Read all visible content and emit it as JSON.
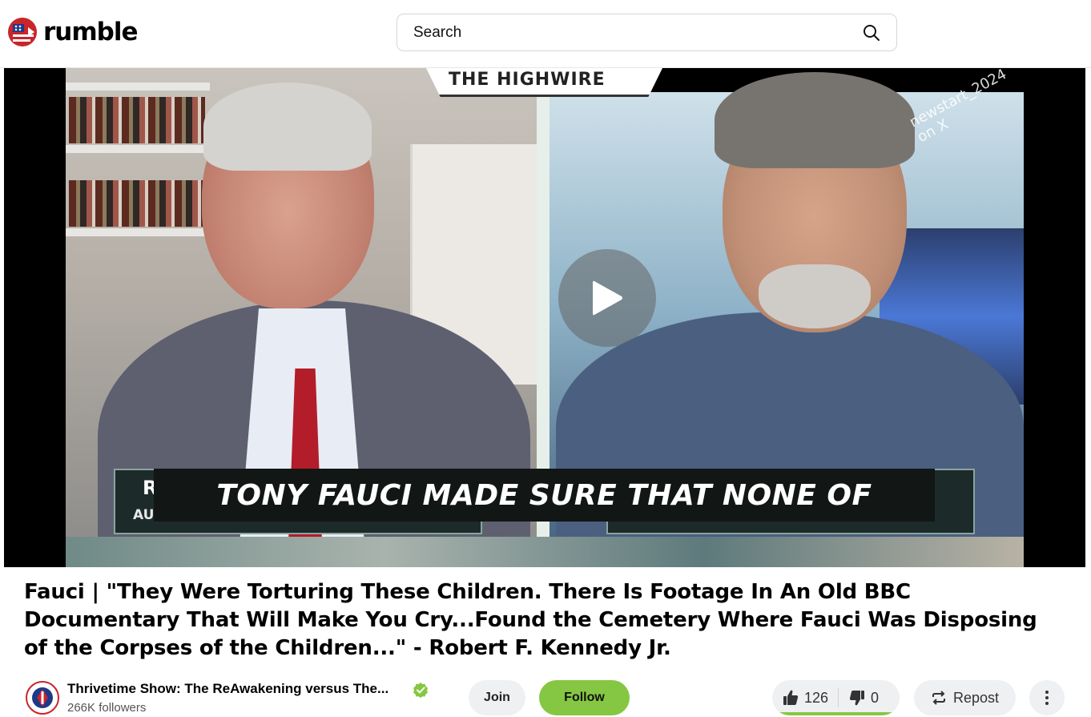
{
  "header": {
    "logo_text": "rumble",
    "search_placeholder": "Search"
  },
  "video": {
    "banner_text": "THE HIGHWIRE",
    "watermark": "newstart_2024 on X",
    "caption": "TONY FAUCI MADE SURE THAT NONE OF",
    "lower_third_letter": "R",
    "lower_third_sub": "AU"
  },
  "title": "Fauci | \"They Were Torturing These Children. There Is Footage In An Old BBC Documentary That Will Make You Cry...Found the Cemetery Where Fauci Was Disposing of the Corpses of the Children...\" - Robert F. Kennedy Jr.",
  "channel": {
    "name": "Thrivetime Show: The ReAwakening versus The...",
    "followers": "266K followers",
    "verified_color": "#85c742"
  },
  "actions": {
    "join_label": "Join",
    "follow_label": "Follow",
    "likes": "126",
    "dislikes": "0",
    "repost_label": "Repost"
  },
  "colors": {
    "accent": "#85c742",
    "pill_bg": "#eef0f2"
  }
}
